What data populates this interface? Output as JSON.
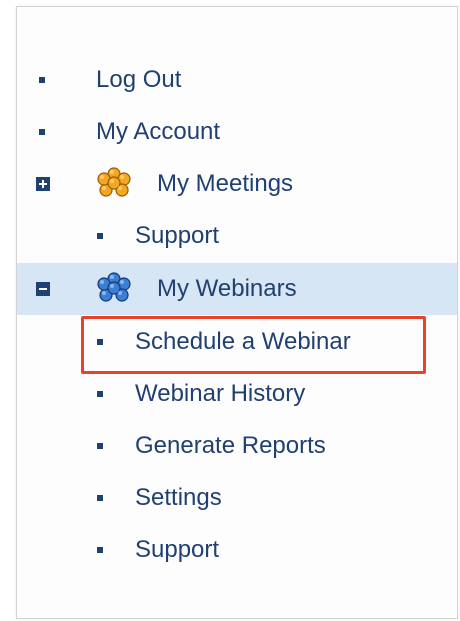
{
  "menu": {
    "log_out": "Log Out",
    "my_account": "My Account",
    "my_meetings": {
      "label": "My Meetings",
      "toggle": "plus-icon",
      "icon": "flower-icon",
      "icon_color": "#f5a623",
      "support": "Support"
    },
    "my_webinars": {
      "label": "My Webinars",
      "toggle": "minus-icon",
      "icon": "flower-icon",
      "icon_color": "#3a7fd5",
      "items": [
        "Schedule a Webinar",
        "Webinar History",
        "Generate Reports",
        "Settings",
        "Support"
      ]
    }
  },
  "colors": {
    "text": "#1f4070",
    "active_row_bg": "#d6e6f5",
    "highlight_border": "#e8432a"
  }
}
